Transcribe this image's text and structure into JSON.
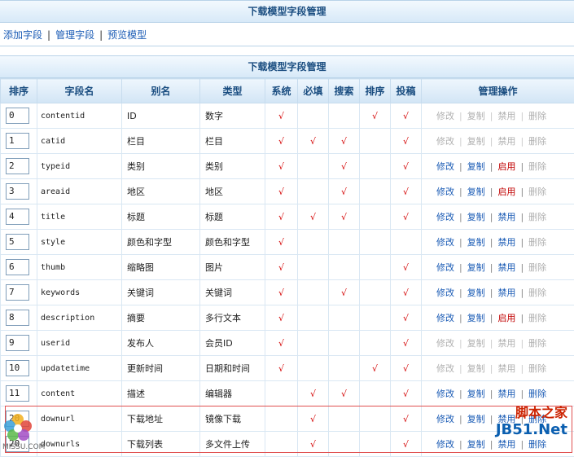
{
  "header": {
    "title": "下载模型字段管理"
  },
  "links": [
    {
      "label": "添加字段"
    },
    {
      "label": "管理字段"
    },
    {
      "label": "预览模型"
    }
  ],
  "table_title": "下载模型字段管理",
  "columns": [
    "排序",
    "字段名",
    "别名",
    "类型",
    "系统",
    "必填",
    "搜索",
    "排序",
    "投稿",
    "管理操作"
  ],
  "check_mark": "√",
  "op_labels": [
    "修改",
    "复制",
    "禁用",
    "删除"
  ],
  "rows": [
    {
      "order": "0",
      "field": "contentid",
      "alias": "ID",
      "type": "数字",
      "sys": true,
      "req": false,
      "search": false,
      "sort": true,
      "post": true,
      "ops": [
        "修改",
        "复制",
        "禁用",
        "删除"
      ],
      "op_state": [
        "dis",
        "dis",
        "dis",
        "dis"
      ]
    },
    {
      "order": "1",
      "field": "catid",
      "alias": "栏目",
      "type": "栏目",
      "sys": true,
      "req": true,
      "search": true,
      "sort": false,
      "post": true,
      "ops": [
        "修改",
        "复制",
        "禁用",
        "删除"
      ],
      "op_state": [
        "dis",
        "dis",
        "dis",
        "dis"
      ]
    },
    {
      "order": "2",
      "field": "typeid",
      "alias": "类别",
      "type": "类别",
      "sys": true,
      "req": false,
      "search": true,
      "sort": false,
      "post": true,
      "ops": [
        "修改",
        "复制",
        "启用",
        "删除"
      ],
      "op_state": [
        "on",
        "on",
        "red",
        "dis"
      ]
    },
    {
      "order": "3",
      "field": "areaid",
      "alias": "地区",
      "type": "地区",
      "sys": true,
      "req": false,
      "search": true,
      "sort": false,
      "post": true,
      "ops": [
        "修改",
        "复制",
        "启用",
        "删除"
      ],
      "op_state": [
        "on",
        "on",
        "red",
        "dis"
      ]
    },
    {
      "order": "4",
      "field": "title",
      "alias": "标题",
      "type": "标题",
      "sys": true,
      "req": true,
      "search": true,
      "sort": false,
      "post": true,
      "ops": [
        "修改",
        "复制",
        "禁用",
        "删除"
      ],
      "op_state": [
        "on",
        "on",
        "on",
        "dis"
      ]
    },
    {
      "order": "5",
      "field": "style",
      "alias": "颜色和字型",
      "type": "颜色和字型",
      "sys": true,
      "req": false,
      "search": false,
      "sort": false,
      "post": false,
      "ops": [
        "修改",
        "复制",
        "禁用",
        "删除"
      ],
      "op_state": [
        "on",
        "on",
        "on",
        "dis"
      ]
    },
    {
      "order": "6",
      "field": "thumb",
      "alias": "缩略图",
      "type": "图片",
      "sys": true,
      "req": false,
      "search": false,
      "sort": false,
      "post": true,
      "ops": [
        "修改",
        "复制",
        "禁用",
        "删除"
      ],
      "op_state": [
        "on",
        "on",
        "on",
        "dis"
      ]
    },
    {
      "order": "7",
      "field": "keywords",
      "alias": "关键词",
      "type": "关键词",
      "sys": true,
      "req": false,
      "search": true,
      "sort": false,
      "post": true,
      "ops": [
        "修改",
        "复制",
        "禁用",
        "删除"
      ],
      "op_state": [
        "on",
        "on",
        "on",
        "dis"
      ]
    },
    {
      "order": "8",
      "field": "description",
      "alias": "摘要",
      "type": "多行文本",
      "sys": true,
      "req": false,
      "search": false,
      "sort": false,
      "post": true,
      "ops": [
        "修改",
        "复制",
        "启用",
        "删除"
      ],
      "op_state": [
        "on",
        "on",
        "red",
        "dis"
      ]
    },
    {
      "order": "9",
      "field": "userid",
      "alias": "发布人",
      "type": "会员ID",
      "sys": true,
      "req": false,
      "search": false,
      "sort": false,
      "post": true,
      "ops": [
        "修改",
        "复制",
        "禁用",
        "删除"
      ],
      "op_state": [
        "dis",
        "dis",
        "dis",
        "dis"
      ]
    },
    {
      "order": "10",
      "field": "updatetime",
      "alias": "更新时间",
      "type": "日期和时间",
      "sys": true,
      "req": false,
      "search": false,
      "sort": true,
      "post": true,
      "ops": [
        "修改",
        "复制",
        "禁用",
        "删除"
      ],
      "op_state": [
        "dis",
        "dis",
        "dis",
        "dis"
      ]
    },
    {
      "order": "11",
      "field": "content",
      "alias": "描述",
      "type": "编辑器",
      "sys": false,
      "req": true,
      "search": true,
      "sort": false,
      "post": true,
      "ops": [
        "修改",
        "复制",
        "禁用",
        "删除"
      ],
      "op_state": [
        "on",
        "on",
        "on",
        "on"
      ]
    },
    {
      "order": "20",
      "field": "downurl",
      "alias": "下载地址",
      "type": "镜像下载",
      "sys": false,
      "req": true,
      "search": false,
      "sort": false,
      "post": true,
      "ops": [
        "修改",
        "复制",
        "禁用",
        "删除"
      ],
      "op_state": [
        "on",
        "on",
        "on",
        "on"
      ]
    },
    {
      "order": "20",
      "field": "downurls",
      "alias": "下载列表",
      "type": "多文件上传",
      "sys": false,
      "req": true,
      "search": false,
      "sort": false,
      "post": true,
      "ops": [
        "修改",
        "复制",
        "禁用",
        "删除"
      ],
      "op_state": [
        "on",
        "on",
        "on",
        "on"
      ]
    }
  ],
  "watermark": {
    "line1": "脚本之家",
    "line2": "JB51.Net"
  },
  "logo_text": "MISSU.COM"
}
